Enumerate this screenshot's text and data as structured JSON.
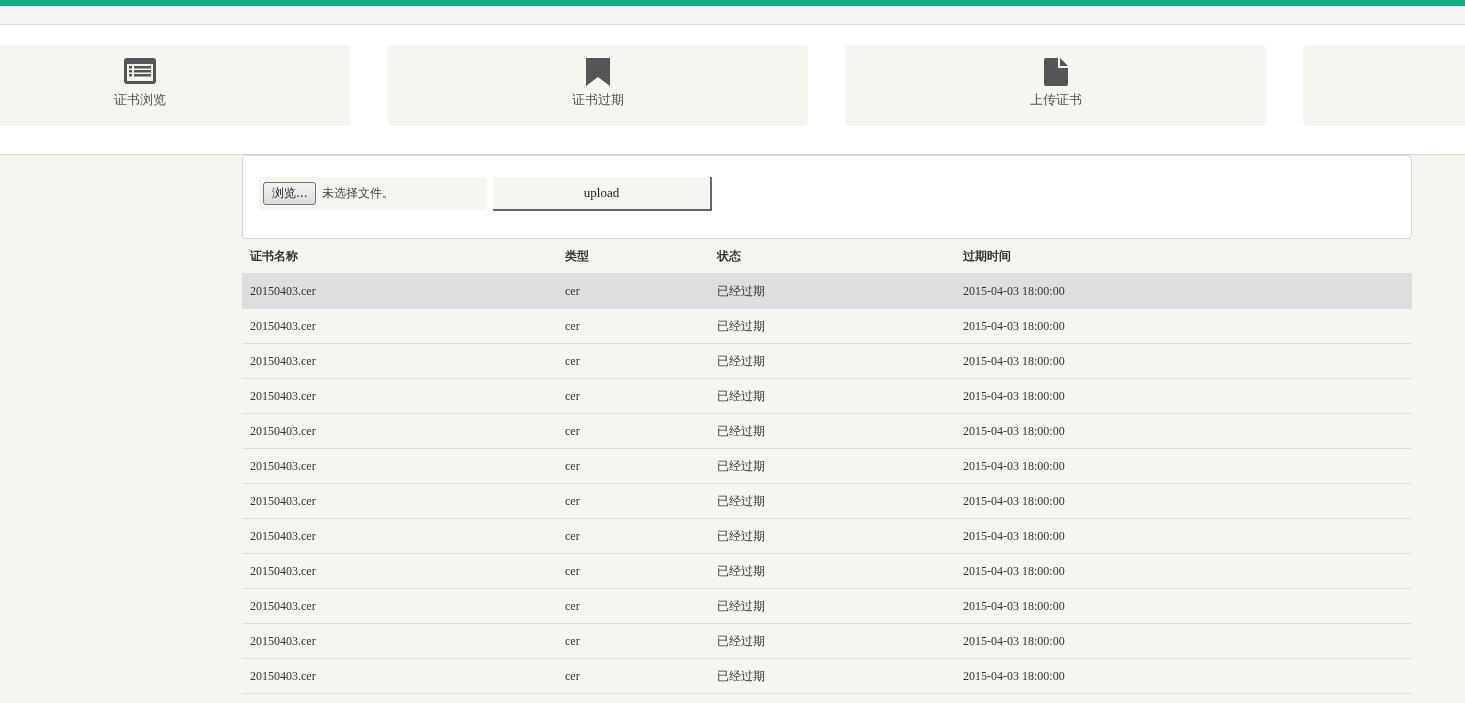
{
  "nav_tiles": [
    {
      "kind": "list",
      "label": "证书浏览"
    },
    {
      "kind": "bookmark",
      "label": "证书过期"
    },
    {
      "kind": "file",
      "label": "上传证书"
    },
    {
      "kind": "blank"
    }
  ],
  "upload_form": {
    "browse_button": "浏览...",
    "file_status": "未选择文件。",
    "upload_button": "upload"
  },
  "table": {
    "columns": [
      "证书名称",
      "类型",
      "状态",
      "过期时间"
    ],
    "rows": [
      {
        "cells": [
          "20150403.cer",
          "cer",
          "已经过期",
          "2015-04-03 18:00:00"
        ],
        "hovered": true
      },
      {
        "cells": [
          "20150403.cer",
          "cer",
          "已经过期",
          "2015-04-03 18:00:00"
        ],
        "hovered": false
      },
      {
        "cells": [
          "20150403.cer",
          "cer",
          "已经过期",
          "2015-04-03 18:00:00"
        ],
        "hovered": false
      },
      {
        "cells": [
          "20150403.cer",
          "cer",
          "已经过期",
          "2015-04-03 18:00:00"
        ],
        "hovered": false
      },
      {
        "cells": [
          "20150403.cer",
          "cer",
          "已经过期",
          "2015-04-03 18:00:00"
        ],
        "hovered": false
      },
      {
        "cells": [
          "20150403.cer",
          "cer",
          "已经过期",
          "2015-04-03 18:00:00"
        ],
        "hovered": false
      },
      {
        "cells": [
          "20150403.cer",
          "cer",
          "已经过期",
          "2015-04-03 18:00:00"
        ],
        "hovered": false
      },
      {
        "cells": [
          "20150403.cer",
          "cer",
          "已经过期",
          "2015-04-03 18:00:00"
        ],
        "hovered": false
      },
      {
        "cells": [
          "20150403.cer",
          "cer",
          "已经过期",
          "2015-04-03 18:00:00"
        ],
        "hovered": false
      },
      {
        "cells": [
          "20150403.cer",
          "cer",
          "已经过期",
          "2015-04-03 18:00:00"
        ],
        "hovered": false
      },
      {
        "cells": [
          "20150403.cer",
          "cer",
          "已经过期",
          "2015-04-03 18:00:00"
        ],
        "hovered": false
      },
      {
        "cells": [
          "20150403.cer",
          "cer",
          "已经过期",
          "2015-04-03 18:00:00"
        ],
        "hovered": false
      }
    ]
  }
}
